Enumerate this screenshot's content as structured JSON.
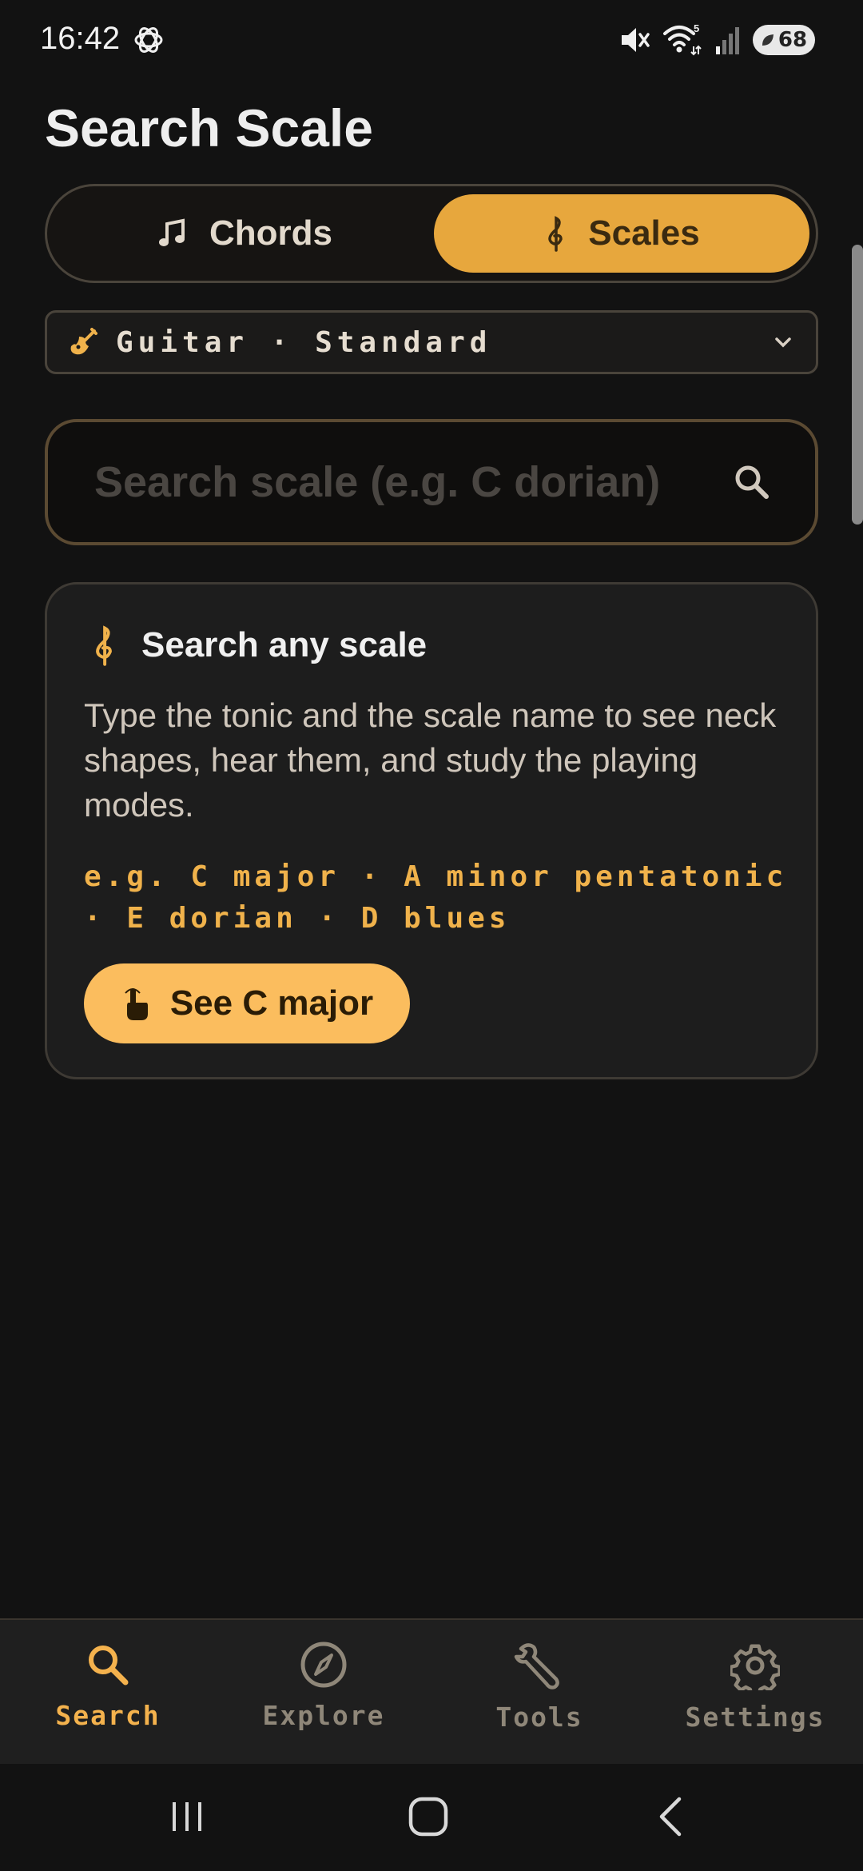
{
  "status_bar": {
    "time": "16:42",
    "battery": "68",
    "icons": [
      "openai-icon",
      "mute-icon",
      "wifi-icon",
      "signal-icon",
      "battery-icon"
    ],
    "wifi_badge": "5"
  },
  "header": {
    "title": "Search Scale"
  },
  "mode_toggle": {
    "chords_label": "Chords",
    "scales_label": "Scales",
    "selected": "Scales"
  },
  "instrument": {
    "label": "Guitar · Standard"
  },
  "search": {
    "placeholder": "Search scale (e.g. C dorian)",
    "value": ""
  },
  "card": {
    "title": "Search any scale",
    "body": "Type the tonic and the scale name to see neck shapes, hear them, and study the playing modes.",
    "examples": "e.g. C major · A minor pentatonic · E dorian · D blues",
    "cta_label": "See C major"
  },
  "bottom_nav": {
    "items": [
      {
        "label": "Search",
        "icon": "search-icon",
        "active": true
      },
      {
        "label": "Explore",
        "icon": "compass-icon",
        "active": false
      },
      {
        "label": "Tools",
        "icon": "wrench-icon",
        "active": false
      },
      {
        "label": "Settings",
        "icon": "gear-icon",
        "active": false
      }
    ]
  },
  "colors": {
    "background": "#121212",
    "accent": "#e7a73d",
    "accent_light": "#fbbd5e",
    "accent_text": "#f0b24b",
    "inactive": "#8f8779"
  }
}
